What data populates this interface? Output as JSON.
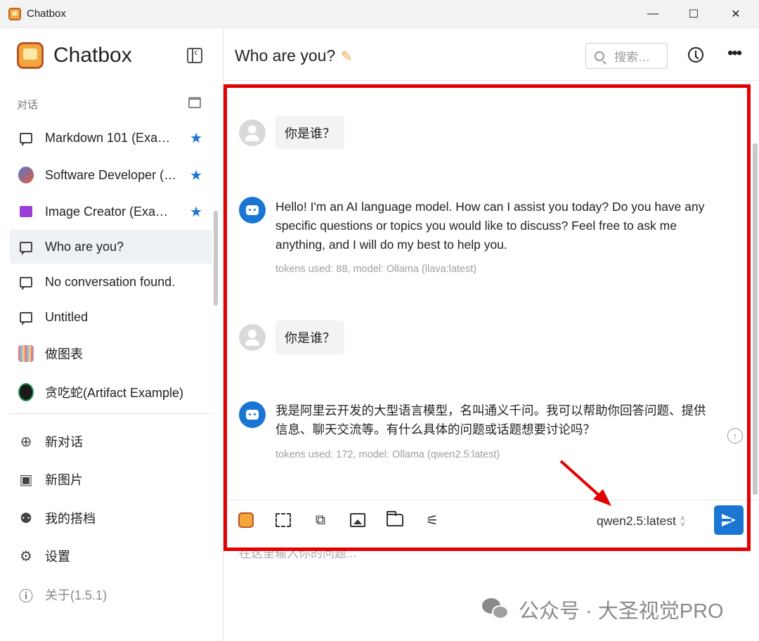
{
  "window": {
    "title": "Chatbox",
    "controls": {
      "minimize": "—",
      "maximize": "☐",
      "close": "✕"
    }
  },
  "sidebar": {
    "brand": "Chatbox",
    "section_label": "对话",
    "conversations": [
      {
        "label": "Markdown 101 (Exa…",
        "icon": "chat-bubble-icon",
        "starred": true,
        "active": false
      },
      {
        "label": "Software Developer (…",
        "icon": "developer-avatar",
        "starred": true,
        "active": false
      },
      {
        "label": "Image Creator (Exa…",
        "icon": "image-icon",
        "starred": true,
        "active": false
      },
      {
        "label": "Who are you?",
        "icon": "chat-bubble-icon",
        "starred": false,
        "active": true
      },
      {
        "label": "No conversation found.",
        "icon": "chat-bubble-icon",
        "starred": false,
        "active": false
      },
      {
        "label": "Untitled",
        "icon": "chat-bubble-icon",
        "starred": false,
        "active": false
      },
      {
        "label": "做图表",
        "icon": "chart-avatar",
        "starred": false,
        "active": false
      },
      {
        "label": "贪吃蛇(Artifact Example)",
        "icon": "snake-avatar",
        "starred": false,
        "active": false
      }
    ],
    "menu": [
      {
        "label": "新对话",
        "icon": "plus-circle-icon"
      },
      {
        "label": "新图片",
        "icon": "add-image-icon"
      },
      {
        "label": "我的搭档",
        "icon": "robot-icon"
      },
      {
        "label": "设置",
        "icon": "gear-icon"
      },
      {
        "label": "关于(1.5.1)",
        "icon": "info-icon"
      }
    ]
  },
  "header": {
    "conversation_title": "Who are you?",
    "search_placeholder": "搜索…"
  },
  "messages": [
    {
      "role": "user",
      "text": "你是谁？"
    },
    {
      "role": "assistant",
      "text": "Hello! I'm an AI language model. How can I assist you today? Do you have any specific questions or topics you would like to discuss? Feel free to ask me anything, and I will do my best to help you.",
      "meta": "tokens used: 88, model: Ollama (llava:latest)"
    },
    {
      "role": "user",
      "text": "你是谁？"
    },
    {
      "role": "assistant",
      "text": "我是阿里云开发的大型语言模型，名叫通义千问。我可以帮助你回答问题、提供信息、聊天交流等。有什么具体的问题或话题想要讨论吗？",
      "meta": "tokens used: 172, model: Ollama (qwen2.5:latest)"
    }
  ],
  "composer": {
    "model": "qwen2.5:latest",
    "input_placeholder": "在这里输入你的问题..."
  },
  "watermark": {
    "text": "公众号 · 大圣视觉PRO"
  },
  "colors": {
    "accent": "#1976d2",
    "annotation": "#e30000",
    "brand": "#f4a63c"
  }
}
